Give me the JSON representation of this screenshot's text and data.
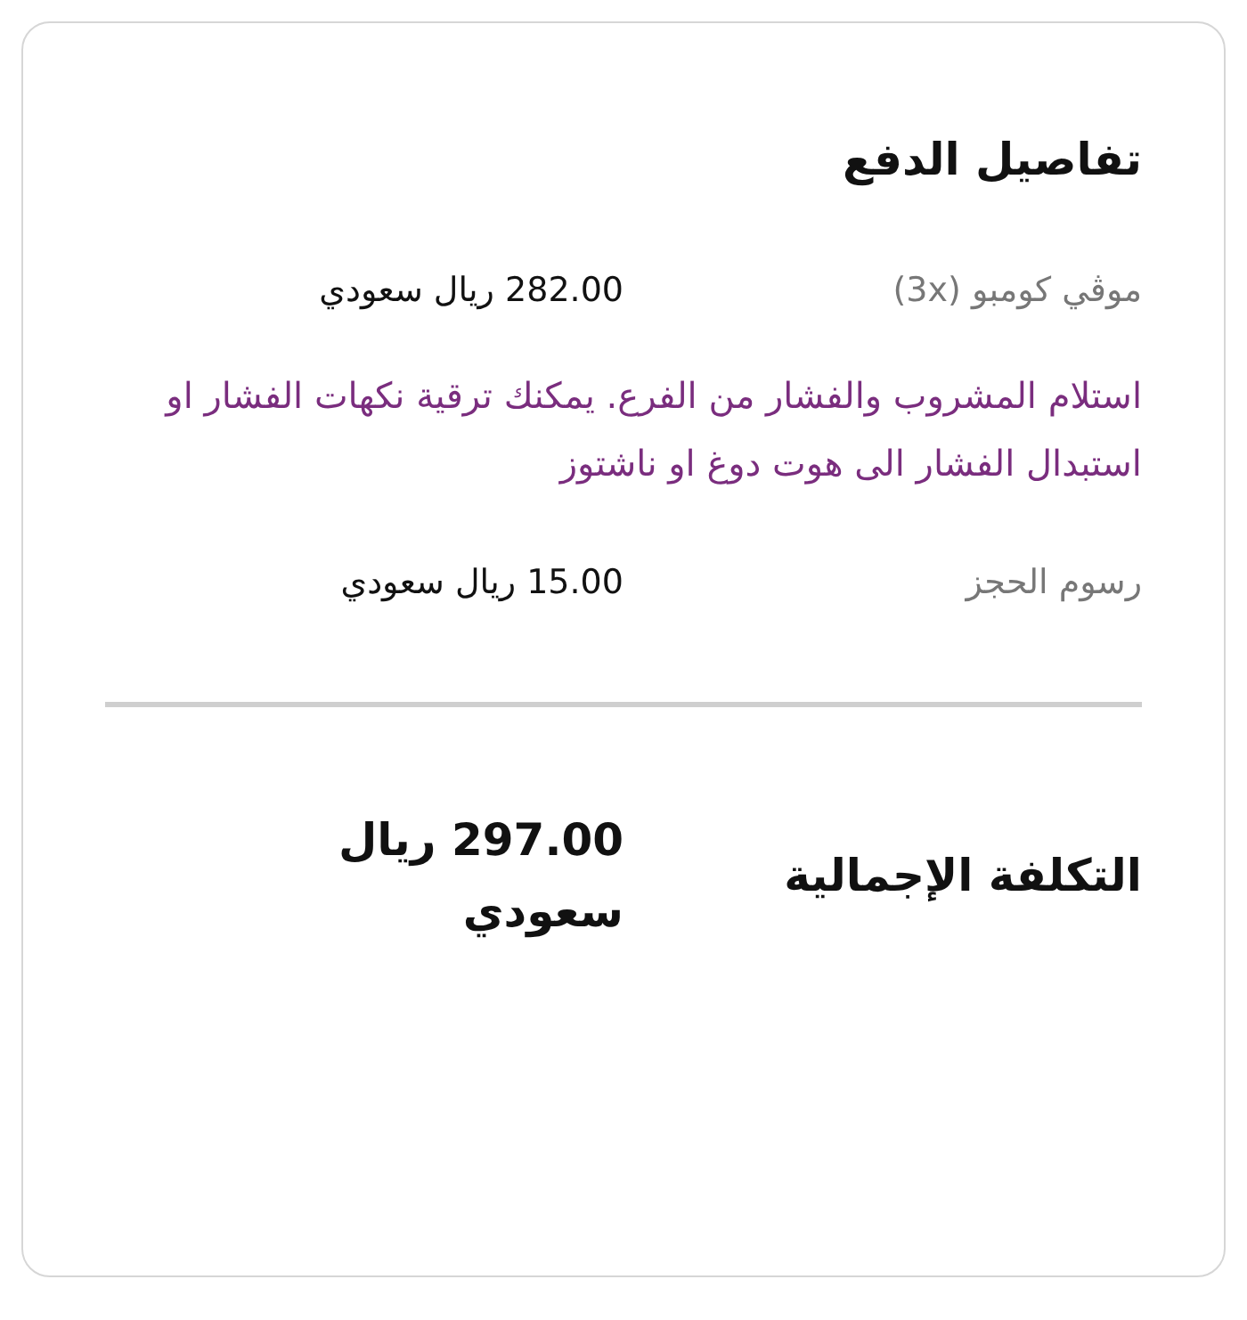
{
  "title": "تفاصيل الدفع",
  "items": [
    {
      "kind": "line",
      "label": "موڤي كومبو (3x)",
      "value": "282.00 ريال سعودي"
    },
    {
      "kind": "note",
      "text": "استلام المشروب والفشار من الفرع. يمكنك ترقية نكهات الفشار او استبدال الفشار الى هوت دوغ او ناشتوز"
    },
    {
      "kind": "line",
      "label": "رسوم الحجز",
      "value": "15.00 ريال سعودي"
    }
  ],
  "total": {
    "label": "التكلفة الإجمالية",
    "value": "297.00 ريال سعودي"
  }
}
